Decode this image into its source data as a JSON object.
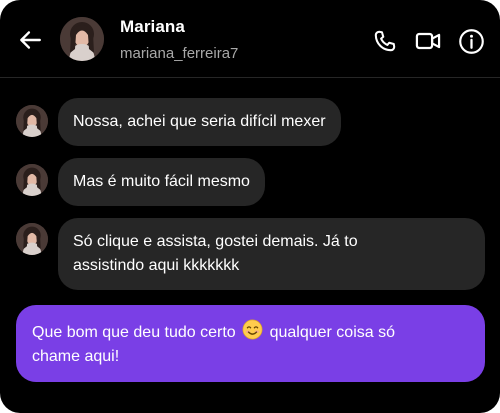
{
  "header": {
    "contact_name": "Mariana",
    "contact_handle": "mariana_ferreira7",
    "icons": [
      "back-arrow-icon",
      "phone-icon",
      "video-camera-icon",
      "info-icon"
    ]
  },
  "messages": [
    {
      "direction": "incoming",
      "text": "Nossa, achei que seria difícil mexer"
    },
    {
      "direction": "incoming",
      "text": "Mas é muito fácil mesmo"
    },
    {
      "direction": "incoming",
      "line1": "Só clique e assista, gostei demais. Já to",
      "line2": "assistindo aqui kkkkkkk"
    },
    {
      "direction": "outgoing",
      "before_emoji": "Que bom que deu tudo certo",
      "emoji": "smiling-face-emoji",
      "after_emoji": "qualquer coisa só",
      "line2": "chame aqui!"
    }
  ],
  "colors": {
    "background": "#000000",
    "incoming_bubble": "#262626",
    "outgoing_bubble": "#7a3fe6",
    "secondary_text": "#a8a8a8"
  }
}
